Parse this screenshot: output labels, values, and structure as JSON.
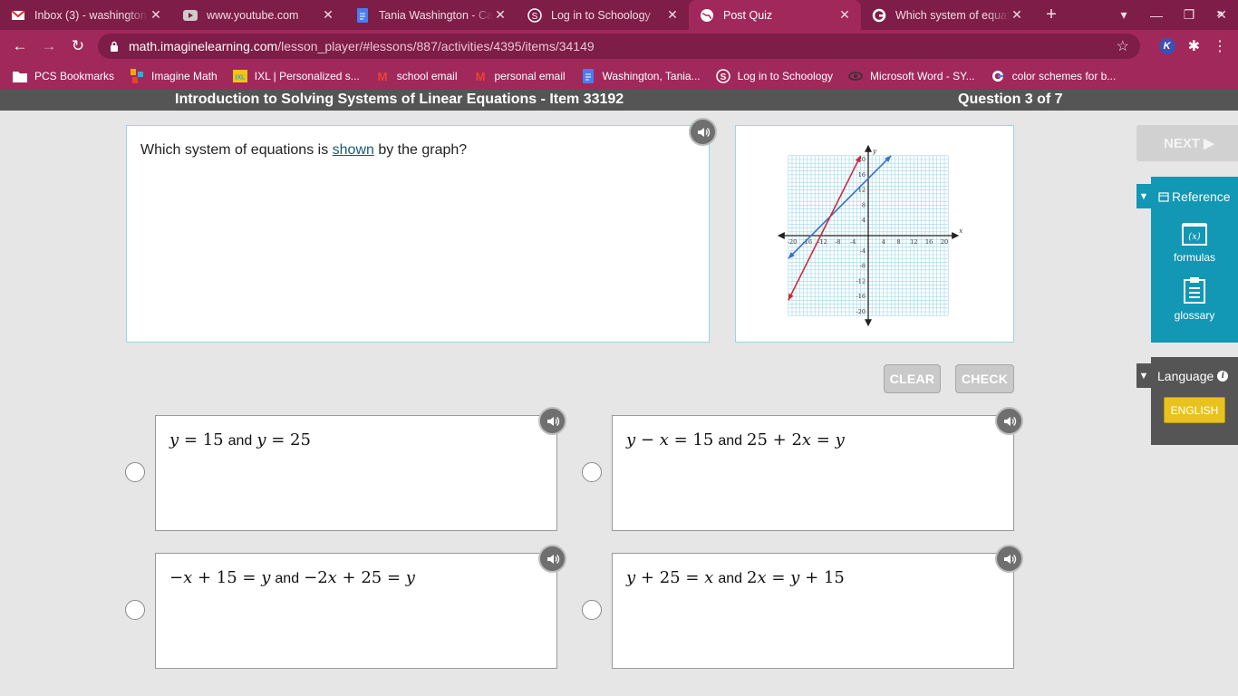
{
  "browser": {
    "tabs": [
      {
        "title": "Inbox (3) - washington",
        "favicon": "gmail-icon"
      },
      {
        "title": "www.youtube.com",
        "favicon": "youtube-icon"
      },
      {
        "title": "Tania Washington - Ca",
        "favicon": "docs-icon"
      },
      {
        "title": "Log in to Schoology",
        "favicon": "schoology-icon"
      },
      {
        "title": "Post Quiz",
        "favicon": "globe-icon",
        "active": true
      },
      {
        "title": "Which system of equat",
        "favicon": "google-icon"
      }
    ],
    "url_host": "math.imaginelearning.com",
    "url_path": "/lesson_player/#lessons/887/activities/4395/items/34149",
    "extension_badge": "K",
    "bookmarks": [
      {
        "label": "PCS Bookmarks",
        "icon": "folder-icon"
      },
      {
        "label": "Imagine Math",
        "icon": "imagine-math-icon"
      },
      {
        "label": "IXL | Personalized s...",
        "icon": "ixl-icon"
      },
      {
        "label": "school email",
        "icon": "gmail-icon"
      },
      {
        "label": "personal email",
        "icon": "gmail-icon"
      },
      {
        "label": "Washington, Tania...",
        "icon": "docs-icon"
      },
      {
        "label": "Log in to Schoology",
        "icon": "schoology-icon"
      },
      {
        "label": "Microsoft Word - SY...",
        "icon": "word-icon"
      },
      {
        "label": "color schemes for b...",
        "icon": "google-icon"
      }
    ],
    "bookmark_icon_text": {
      "ixl": "IXL",
      "gmail_mark": "M",
      "schoology_mark": "S"
    }
  },
  "lesson": {
    "title": "Introduction to Solving Systems of Linear Equations - Item 33192",
    "question_counter": "Question 3 of 7"
  },
  "prompt": {
    "before": "Which system of equations is ",
    "link": "shown",
    "after": " by the graph?"
  },
  "graph": {
    "x_ticks": [
      "-20",
      "-16",
      "-12",
      "-8",
      "-4",
      "4",
      "8",
      "12",
      "16",
      "20"
    ],
    "y_ticks": [
      "20",
      "16",
      "12",
      "8",
      "4",
      "-4",
      "-8",
      "-12",
      "-16",
      "-20"
    ],
    "x_axis_label": "x",
    "y_axis_label": "y",
    "lines": [
      {
        "color": "#3a6fc4",
        "slope": 1,
        "intercept": 15
      },
      {
        "color": "#cc2a3b",
        "slope": 2,
        "intercept": 25
      }
    ],
    "grid_color": "#9dd6e8"
  },
  "buttons": {
    "clear": "CLEAR",
    "check": "CHECK",
    "next": "NEXT ▶"
  },
  "options": [
    {
      "left": [
        {
          "t": "i",
          "v": "y"
        },
        {
          "t": "o",
          "v": " = "
        },
        {
          "t": "n",
          "v": "15"
        }
      ],
      "and": "and",
      "right": [
        {
          "t": "i",
          "v": "y"
        },
        {
          "t": "o",
          "v": " = "
        },
        {
          "t": "n",
          "v": "25"
        }
      ]
    },
    {
      "left": [
        {
          "t": "i",
          "v": "y"
        },
        {
          "t": "o",
          "v": " − "
        },
        {
          "t": "i",
          "v": "x"
        },
        {
          "t": "o",
          "v": " = "
        },
        {
          "t": "n",
          "v": "15"
        }
      ],
      "and": "and",
      "right": [
        {
          "t": "n",
          "v": "25"
        },
        {
          "t": "o",
          "v": " + "
        },
        {
          "t": "n",
          "v": "2"
        },
        {
          "t": "i",
          "v": "x"
        },
        {
          "t": "o",
          "v": " = "
        },
        {
          "t": "i",
          "v": "y"
        }
      ]
    },
    {
      "left": [
        {
          "t": "o",
          "v": "−"
        },
        {
          "t": "i",
          "v": "x"
        },
        {
          "t": "o",
          "v": " + "
        },
        {
          "t": "n",
          "v": "15"
        },
        {
          "t": "o",
          "v": " = "
        },
        {
          "t": "i",
          "v": "y"
        }
      ],
      "and": "and",
      "right": [
        {
          "t": "o",
          "v": "−"
        },
        {
          "t": "n",
          "v": "2"
        },
        {
          "t": "i",
          "v": "x"
        },
        {
          "t": "o",
          "v": " + "
        },
        {
          "t": "n",
          "v": "25"
        },
        {
          "t": "o",
          "v": " = "
        },
        {
          "t": "i",
          "v": "y"
        }
      ]
    },
    {
      "left": [
        {
          "t": "i",
          "v": "y"
        },
        {
          "t": "o",
          "v": " + "
        },
        {
          "t": "n",
          "v": "25"
        },
        {
          "t": "o",
          "v": " = "
        },
        {
          "t": "i",
          "v": "x"
        }
      ],
      "and": "and",
      "right": [
        {
          "t": "n",
          "v": "2"
        },
        {
          "t": "i",
          "v": "x"
        },
        {
          "t": "o",
          "v": " = "
        },
        {
          "t": "i",
          "v": "y"
        },
        {
          "t": "o",
          "v": " + "
        },
        {
          "t": "n",
          "v": "15"
        }
      ]
    }
  ],
  "sidebar": {
    "reference_label": "Reference",
    "formulas_label": "formulas",
    "formulas_icon_text": "(x)",
    "glossary_label": "glossary",
    "language_label": "Language",
    "english_label": "ENGLISH"
  },
  "colors": {
    "chrome_dark": "#7d1d48",
    "chrome_light": "#a1285a",
    "reference_teal": "#1297b5",
    "english_yellow": "#e8c31f"
  }
}
